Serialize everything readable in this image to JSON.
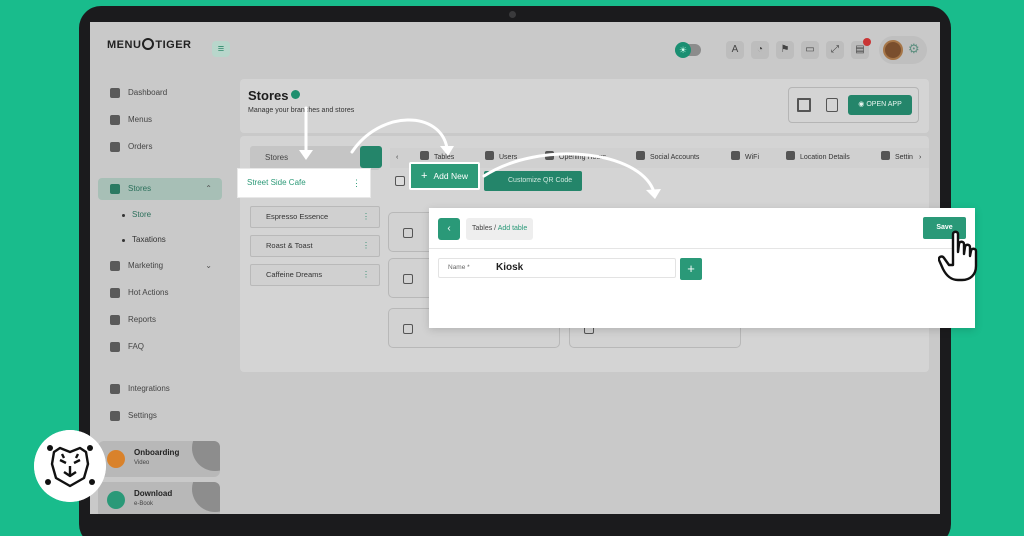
{
  "brand": {
    "logo_text": "MENUTIGER"
  },
  "sidebar": {
    "items": [
      {
        "label": "Dashboard"
      },
      {
        "label": "Menus"
      },
      {
        "label": "Orders"
      },
      {
        "label": "Stores"
      },
      {
        "label": "Marketing"
      },
      {
        "label": "Hot Actions"
      },
      {
        "label": "Reports"
      },
      {
        "label": "FAQ"
      },
      {
        "label": "Integrations"
      },
      {
        "label": "Settings"
      }
    ],
    "sub_items": [
      {
        "label": "Store"
      },
      {
        "label": "Taxations"
      }
    ],
    "promos": [
      {
        "title": "Onboarding",
        "subtitle": "Video"
      },
      {
        "title": "Download",
        "subtitle": "e-Book"
      }
    ]
  },
  "header": {
    "title": "Stores",
    "subtitle": "Manage your branches and stores",
    "open_app_label": "OPEN APP"
  },
  "stores_panel": {
    "heading": "Stores",
    "items": [
      {
        "label": "Street Side Cafe"
      },
      {
        "label": "Espresso Essence"
      },
      {
        "label": "Roast & Toast"
      },
      {
        "label": "Caffeine Dreams"
      }
    ]
  },
  "tabs": [
    {
      "label": "Tables"
    },
    {
      "label": "Users"
    },
    {
      "label": "Opening Hours"
    },
    {
      "label": "Social Accounts"
    },
    {
      "label": "WiFi"
    },
    {
      "label": "Location Details"
    },
    {
      "label": "Settin"
    }
  ],
  "actions": {
    "add_new_label": "Add New",
    "customize_label": "Customize QR Code"
  },
  "modal": {
    "breadcrumb_parent": "Tables",
    "breadcrumb_separator": " / ",
    "breadcrumb_current": "Add table",
    "save_label": "Save",
    "name_label": "Name *",
    "name_value": "Kiosk"
  },
  "colors": {
    "background": "#19bc8c",
    "accent": "#2a9978",
    "frame": "#1b1b1d"
  }
}
